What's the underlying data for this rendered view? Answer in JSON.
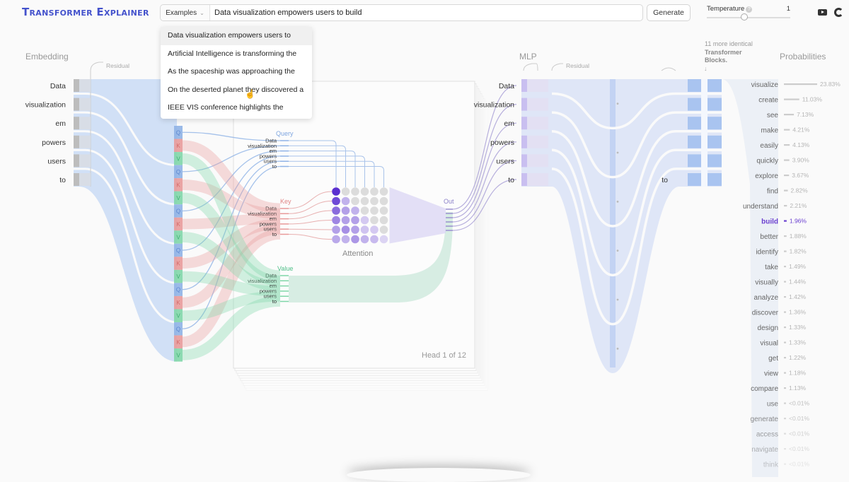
{
  "app": {
    "title": "Transformer Explainer"
  },
  "header": {
    "examples_label": "Examples",
    "prompt_value": "Data visualization empowers users to build",
    "generate_label": "Generate",
    "temperature_label": "Temperature",
    "temperature_help": "?",
    "temperature_value": "1",
    "temperature_fraction": 0.45
  },
  "dropdown": {
    "items": [
      "Data visualization empowers users to",
      "Artificial Intelligence is transforming the",
      "As the spaceship was approaching the",
      "On the deserted planet they discovered a",
      "IEEE VIS conference highlights the"
    ]
  },
  "sections": {
    "embedding": "Embedding",
    "residual": "Residual",
    "mlp": "MLP",
    "residual2": "Residual",
    "probabilities": "Probabilities",
    "attention": "Attention",
    "query": "Query",
    "key": "Key",
    "value": "Value",
    "out": "Out",
    "head": "Head 1 of 12",
    "blocks_note_1": "11 more identical",
    "blocks_note_2": "Transformer",
    "blocks_note_3": "Blocks."
  },
  "tokens": [
    "Data",
    "visualization",
    "em",
    "powers",
    "users",
    "to"
  ],
  "last_token": "to",
  "qkv_letters": [
    "Q",
    "K",
    "V"
  ],
  "attention_weights": [
    [
      1.0,
      0,
      0,
      0,
      0,
      0
    ],
    [
      0.85,
      0.25,
      0,
      0,
      0,
      0
    ],
    [
      0.65,
      0.35,
      0.25,
      0,
      0,
      0
    ],
    [
      0.5,
      0.35,
      0.35,
      0.12,
      0,
      0
    ],
    [
      0.35,
      0.45,
      0.35,
      0.15,
      0.12,
      0
    ],
    [
      0.3,
      0.25,
      0.4,
      0.25,
      0.2,
      0.05
    ]
  ],
  "probabilities": [
    {
      "token": "visualize",
      "pct": "23.83%",
      "value": 23.83
    },
    {
      "token": "create",
      "pct": "11.03%",
      "value": 11.03
    },
    {
      "token": "see",
      "pct": "7.13%",
      "value": 7.13
    },
    {
      "token": "make",
      "pct": "4.21%",
      "value": 4.21
    },
    {
      "token": "easily",
      "pct": "4.13%",
      "value": 4.13
    },
    {
      "token": "quickly",
      "pct": "3.90%",
      "value": 3.9
    },
    {
      "token": "explore",
      "pct": "3.67%",
      "value": 3.67
    },
    {
      "token": "find",
      "pct": "2.82%",
      "value": 2.82
    },
    {
      "token": "understand",
      "pct": "2.21%",
      "value": 2.21
    },
    {
      "token": "build",
      "pct": "1.96%",
      "value": 1.96,
      "selected": true
    },
    {
      "token": "better",
      "pct": "1.88%",
      "value": 1.88
    },
    {
      "token": "identify",
      "pct": "1.82%",
      "value": 1.82
    },
    {
      "token": "take",
      "pct": "1.49%",
      "value": 1.49
    },
    {
      "token": "visually",
      "pct": "1.44%",
      "value": 1.44
    },
    {
      "token": "analyze",
      "pct": "1.42%",
      "value": 1.42
    },
    {
      "token": "discover",
      "pct": "1.36%",
      "value": 1.36
    },
    {
      "token": "design",
      "pct": "1.33%",
      "value": 1.33
    },
    {
      "token": "visual",
      "pct": "1.33%",
      "value": 1.33
    },
    {
      "token": "get",
      "pct": "1.22%",
      "value": 1.22
    },
    {
      "token": "view",
      "pct": "1.18%",
      "value": 1.18
    },
    {
      "token": "compare",
      "pct": "1.13%",
      "value": 1.13
    },
    {
      "token": "use",
      "pct": "<0.01%",
      "value": 0.01
    },
    {
      "token": "generate",
      "pct": "<0.01%",
      "value": 0.01
    },
    {
      "token": "access",
      "pct": "<0.01%",
      "value": 0.01
    },
    {
      "token": "navigate",
      "pct": "<0.01%",
      "value": 0.01
    },
    {
      "token": "think",
      "pct": "<0.01%",
      "value": 0.01
    }
  ],
  "colors": {
    "brand": "#3b4fcf",
    "query": "#8fb3e6",
    "key": "#e89a9a",
    "value": "#7fd6a8",
    "attention": "#5a2fd0",
    "selected": "#6a3fd0",
    "embedding": "#c9dbf5"
  },
  "icons": {
    "youtube": "youtube-icon",
    "github": "github-icon",
    "help": "help-circle-icon",
    "chevron": "chevron-down-icon",
    "cursor": "hand-pointer-icon"
  }
}
